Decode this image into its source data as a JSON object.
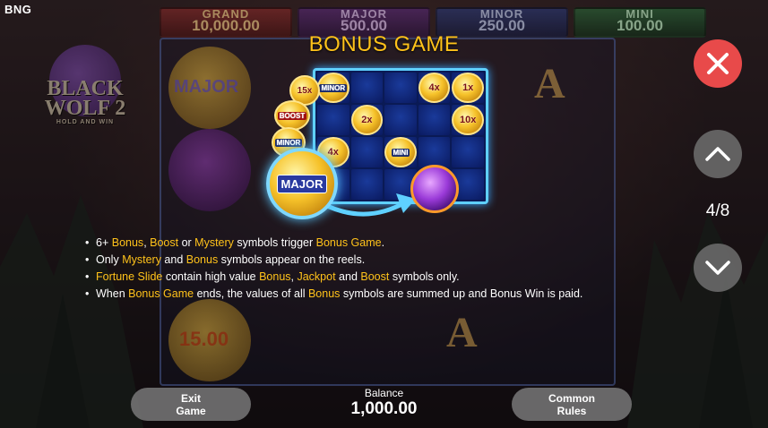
{
  "brand": "BNG",
  "jackpots": [
    {
      "name": "GRAND",
      "value": "10,000.00"
    },
    {
      "name": "MAJOR",
      "value": "500.00"
    },
    {
      "name": "MINOR",
      "value": "250.00"
    },
    {
      "name": "MINI",
      "value": "100.00"
    }
  ],
  "logo": {
    "line1": "BLACK",
    "line2": "WOLF 2",
    "tagline": "HOLD AND WIN"
  },
  "reels": {
    "major_label": "MAJOR",
    "coin_value": "15.00",
    "symbol_a": "A"
  },
  "bonus": {
    "title": "BONUS GAME",
    "coins": {
      "minor": "MINOR",
      "x4a": "4x",
      "x1": "1x",
      "x2": "2x",
      "x10": "10x",
      "x4b": "4x",
      "mini": "MINI",
      "x15": "15x",
      "boost": "BOOST",
      "minor2": "MINOR",
      "major": "MAJOR"
    }
  },
  "rules": {
    "r1": {
      "a": "6+ ",
      "b": "Bonus",
      "c": ", ",
      "d": "Boost",
      "e": " or ",
      "f": "Mystery",
      "g": " symbols trigger ",
      "h": "Bonus Game",
      "i": "."
    },
    "r2": {
      "a": "Only ",
      "b": "Mystery",
      "c": " and ",
      "d": "Bonus",
      "e": " symbols appear on the reels."
    },
    "r3": {
      "a": "Fortune Slide",
      "b": " contain high value ",
      "c": "Bonus",
      "d": ", ",
      "e": "Jackpot",
      "f": " and ",
      "g": "Boost",
      "h": " symbols only."
    },
    "r4": {
      "a": "When ",
      "b": "Bonus Game",
      "c": " ends, the values of all ",
      "d": "Bonus",
      "e": " symbols are summed up and Bonus Win is paid."
    }
  },
  "pagination": {
    "current": "4/8"
  },
  "bottom": {
    "exit_line1": "Exit",
    "exit_line2": "Game",
    "balance_label": "Balance",
    "balance_value": "1,000.00",
    "rules_line1": "Common",
    "rules_line2": "Rules"
  },
  "icons": {
    "close": "close-icon",
    "up": "chevron-up-icon",
    "down": "chevron-down-icon"
  },
  "colors": {
    "highlight": "#ffc21a",
    "close_button": "#e84a4a",
    "panel_border": "#5fd0ff"
  }
}
